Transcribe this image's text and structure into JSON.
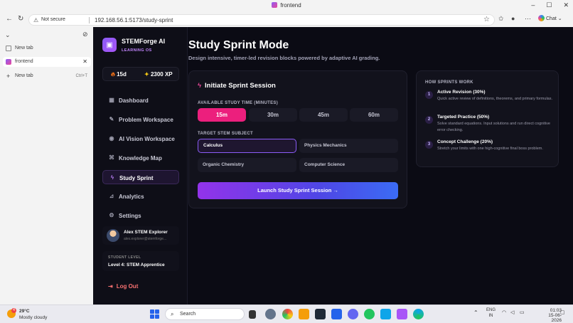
{
  "window": {
    "title": "frontend",
    "controls": [
      "–",
      "☐",
      "✕"
    ]
  },
  "browser": {
    "security_label": "Not secure",
    "url": "192.168.56.1:5173/study-sprint",
    "chat_label": "Chat"
  },
  "tabs": {
    "items": [
      {
        "label": "New tab",
        "active": false
      },
      {
        "label": "frontend",
        "active": true
      }
    ],
    "new_tab_label": "New tab",
    "new_tab_shortcut": "Ctrl+T"
  },
  "app": {
    "brand": {
      "name": "STEMForge AI",
      "subtitle": "LEARNING OS"
    },
    "stats": {
      "streak": "15d",
      "xp": "2300 XP"
    },
    "nav": [
      {
        "label": "Dashboard",
        "icon": "dashboard-icon",
        "active": false
      },
      {
        "label": "Problem Workspace",
        "icon": "edit-icon",
        "active": false
      },
      {
        "label": "AI Vision Workspace",
        "icon": "eye-icon",
        "active": false
      },
      {
        "label": "Knowledge Map",
        "icon": "map-icon",
        "active": false
      },
      {
        "label": "Study Sprint",
        "icon": "lightning-icon",
        "active": true
      },
      {
        "label": "Analytics",
        "icon": "chart-icon",
        "active": false
      },
      {
        "label": "Settings",
        "icon": "gear-icon",
        "active": false
      }
    ],
    "user": {
      "name": "Alex STEM Explorer",
      "email": "alex.explorer@stemforge..."
    },
    "level": {
      "label": "STUDENT LEVEL",
      "value": "Level 4: STEM Apprentice"
    },
    "logout_label": "Log Out",
    "page": {
      "title": "Study Sprint Mode",
      "subtitle": "Design intensive, timer-led revision blocks powered by adaptive AI grading."
    },
    "sprint": {
      "title": "Initiate Sprint Session",
      "time_label": "AVAILABLE STUDY TIME (MINUTES)",
      "times": [
        {
          "label": "15m",
          "active": true
        },
        {
          "label": "30m",
          "active": false
        },
        {
          "label": "45m",
          "active": false
        },
        {
          "label": "60m",
          "active": false
        }
      ],
      "subject_label": "TARGET STEM SUBJECT",
      "subjects": [
        {
          "label": "Calculus",
          "active": true
        },
        {
          "label": "Physics Mechanics",
          "active": false
        },
        {
          "label": "Organic Chemistry",
          "active": false
        },
        {
          "label": "Computer Science",
          "active": false
        }
      ],
      "launch_label": "Launch Study Sprint Session"
    },
    "how": {
      "title": "HOW SPRINTS WORK",
      "steps": [
        {
          "num": "1",
          "title": "Active Revision (30%)",
          "desc": "Quick active review of definitions, theorems, and primary formulas."
        },
        {
          "num": "2",
          "title": "Targeted Practice (50%)",
          "desc": "Solve standard equations. Input solutions and run direct cognitive error checking."
        },
        {
          "num": "3",
          "title": "Concept Challenge (20%)",
          "desc": "Stretch your limits with one high-cognitive final boss problem."
        }
      ]
    }
  },
  "taskbar": {
    "weather": {
      "temp": "29°C",
      "desc": "Mostly cloudy",
      "badge": "4"
    },
    "search_placeholder": "Search",
    "lang": "ENG",
    "region": "IN",
    "time": "01:03",
    "date": "15-06-2026"
  }
}
